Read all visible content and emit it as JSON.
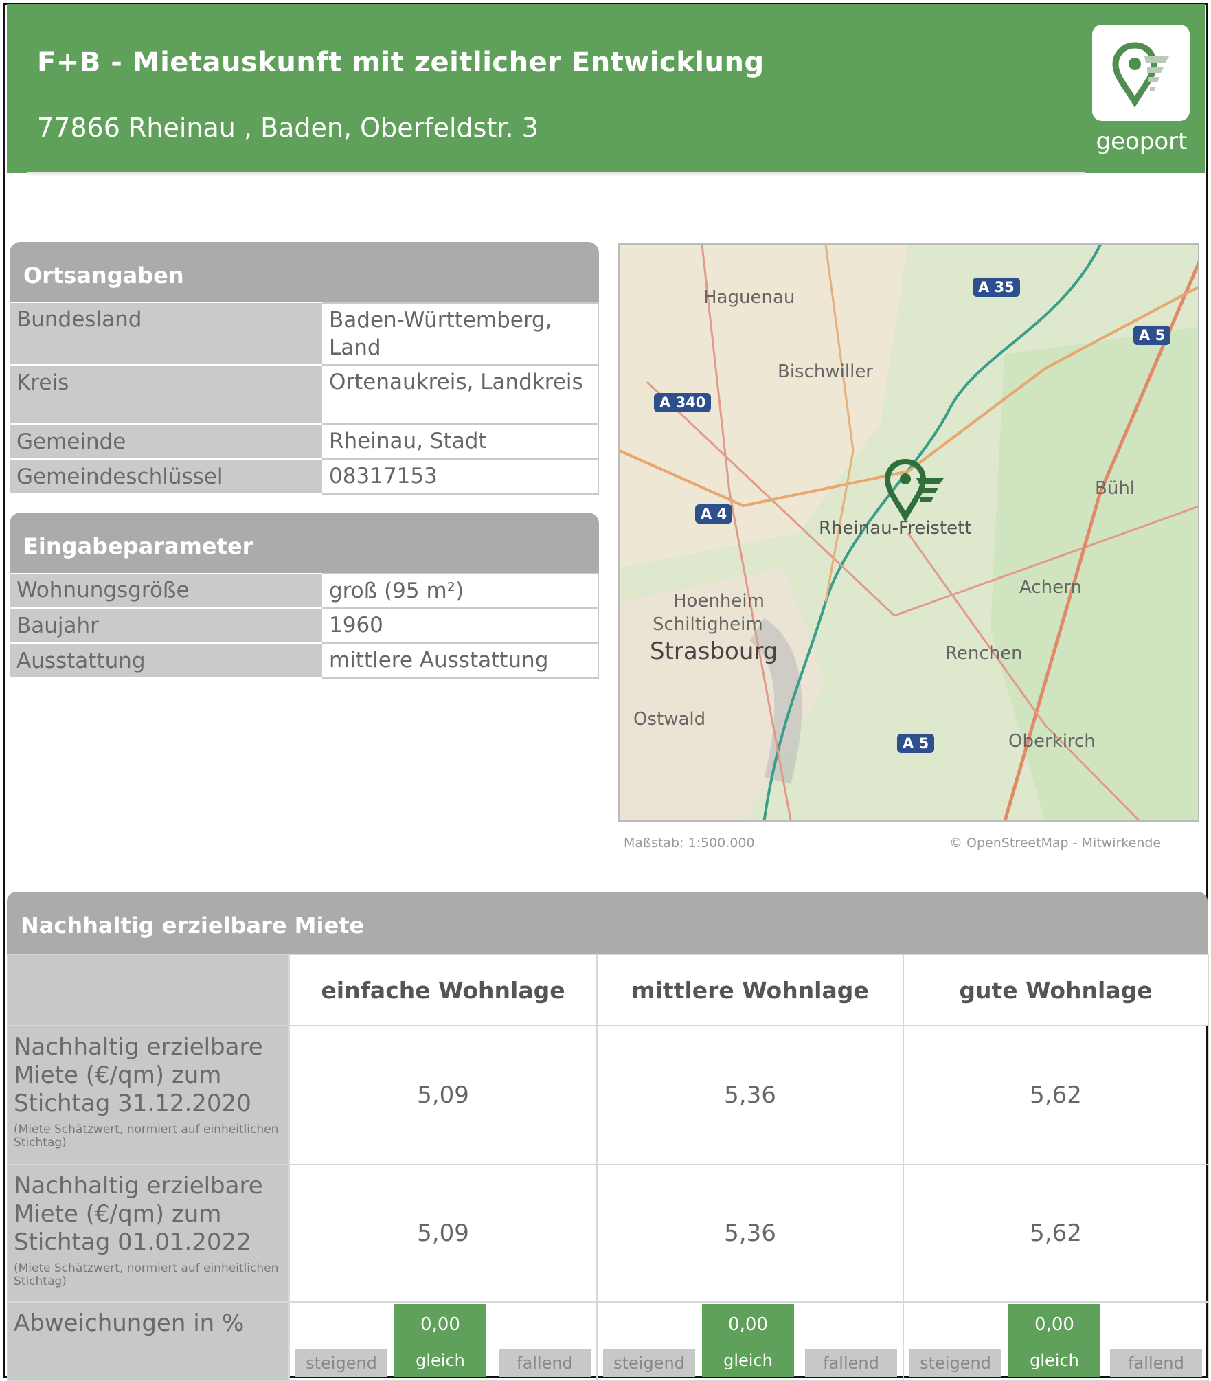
{
  "header": {
    "title": "F+B - Mietauskunft mit zeitlicher Entwicklung",
    "address": "77866 Rheinau , Baden, Oberfeldstr. 3",
    "logo_text": "geoport",
    "logo_icon": "map-pin-icon",
    "background_color": "#5fa05a"
  },
  "ortsangaben": {
    "heading": "Ortsangaben",
    "rows": [
      {
        "key": "Bundesland",
        "value": "Baden-Württemberg, Land"
      },
      {
        "key": "Kreis",
        "value": "Ortenaukreis, Landkreis"
      },
      {
        "key": "Gemeinde",
        "value": "Rheinau, Stadt"
      },
      {
        "key": "Gemeindeschlüssel",
        "value": "08317153"
      }
    ]
  },
  "eingabeparameter": {
    "heading": "Eingabeparameter",
    "rows": [
      {
        "key": "Wohnungsgröße",
        "value": "groß (95 m²)"
      },
      {
        "key": "Baujahr",
        "value": "1960"
      },
      {
        "key": "Ausstattung",
        "value": "mittlere Ausstattung"
      }
    ]
  },
  "map": {
    "places": [
      "Haguenau",
      "Bischwiller",
      "Bühl",
      "Rheinau-Freistett",
      "Achern",
      "Hoenheim",
      "Schiltigheim",
      "Strasbourg",
      "Renchen",
      "Ostwald",
      "Oberkirch"
    ],
    "roads": [
      "A 35",
      "A 5",
      "A 340",
      "A 4",
      "A 5"
    ],
    "scale": "Maßstab: 1:500.000",
    "credit": "© OpenStreetMap - Mitwirkende"
  },
  "rent": {
    "heading": "Nachhaltig erzielbare Miete",
    "columns": [
      "einfache Wohnlage",
      "mittlere Wohnlage",
      "gute Wohnlage"
    ],
    "rows": [
      {
        "label": "Nachhaltig erzielbare Miete (€/qm) zum Stichtag 31.12.2020",
        "note": "(Miete Schätzwert, normiert auf einheitlichen Stichtag)",
        "values": [
          "5,09",
          "5,36",
          "5,62"
        ]
      },
      {
        "label": "Nachhaltig erzielbare Miete (€/qm) zum Stichtag 01.01.2022",
        "note": "(Miete Schätzwert, normiert auf einheitlichen Stichtag)",
        "values": [
          "5,09",
          "5,36",
          "5,62"
        ]
      }
    ],
    "deviation": {
      "label": "Abweichungen in %",
      "cells": [
        {
          "steigend": "steigend",
          "gleich": "gleich",
          "fallend": "fallend",
          "value": "0,00"
        },
        {
          "steigend": "steigend",
          "gleich": "gleich",
          "fallend": "fallend",
          "value": "0,00"
        },
        {
          "steigend": "steigend",
          "gleich": "gleich",
          "fallend": "fallend",
          "value": "0,00"
        }
      ]
    }
  }
}
